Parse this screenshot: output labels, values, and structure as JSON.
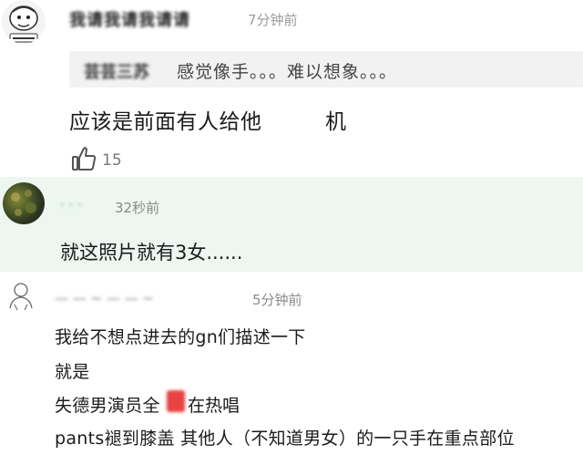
{
  "comments": [
    {
      "username": "我请我请我请请",
      "time": "7分钟前",
      "quote": {
        "name": "芸芸三苏",
        "text": "感觉像手。。。难以想象。。。"
      },
      "body_before": "应该是前面有人给他",
      "body_after": "机",
      "like_count": "15"
    },
    {
      "username": "· · ·",
      "time": "32秒前",
      "text": "就这照片就有3女......"
    },
    {
      "username": "— — ~ — — ~",
      "time": "5分钟前",
      "lines": [
        "我给不想点进去的gn们描述一下",
        "就是",
        "失德男演员全",
        "在热唱",
        "pants褪到膝盖 其他人（不知道男女）的一只手在重点部位"
      ]
    }
  ],
  "icons": {
    "comment1_avatar": "cartoon-avatar-icon",
    "comment2_avatar": "photo-avatar",
    "comment3_avatar": "sketch-avatar-icon",
    "like": "thumbs-up-icon"
  },
  "colors": {
    "comment2_background": "#edf6f0",
    "quote_background": "#f2f2f2",
    "time_text": "#9a9a9a",
    "censor_mark": "#e84444"
  }
}
